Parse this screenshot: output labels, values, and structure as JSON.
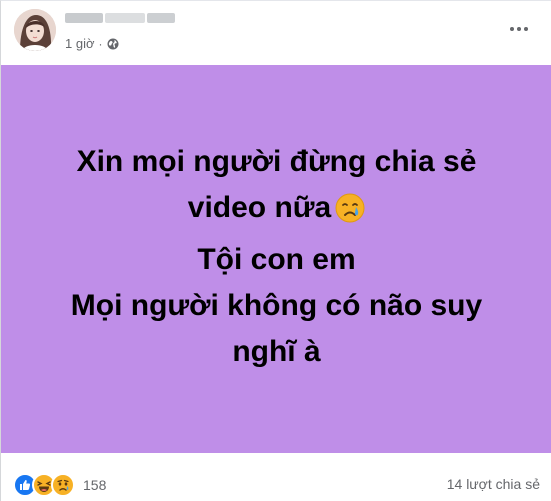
{
  "post": {
    "time": "1 giờ",
    "separator": "·",
    "privacy_icon": "globe-icon",
    "background_color": "#bf8ee8",
    "text_lines": [
      "Xin mọi người đừng chia sẻ",
      "video nữa",
      "Tội con em",
      "Mọi người không có não suy",
      "nghĩ à"
    ],
    "emoji_icon": "crying-face-icon"
  },
  "reactions": {
    "icons": [
      "like-icon",
      "haha-icon",
      "sad-icon"
    ],
    "count": "158"
  },
  "shares": {
    "label": "14 lượt chia sẻ"
  },
  "colors": {
    "meta_text": "#65676b",
    "like_blue": "#1877f2",
    "emoji_yellow": "#f7b125"
  }
}
